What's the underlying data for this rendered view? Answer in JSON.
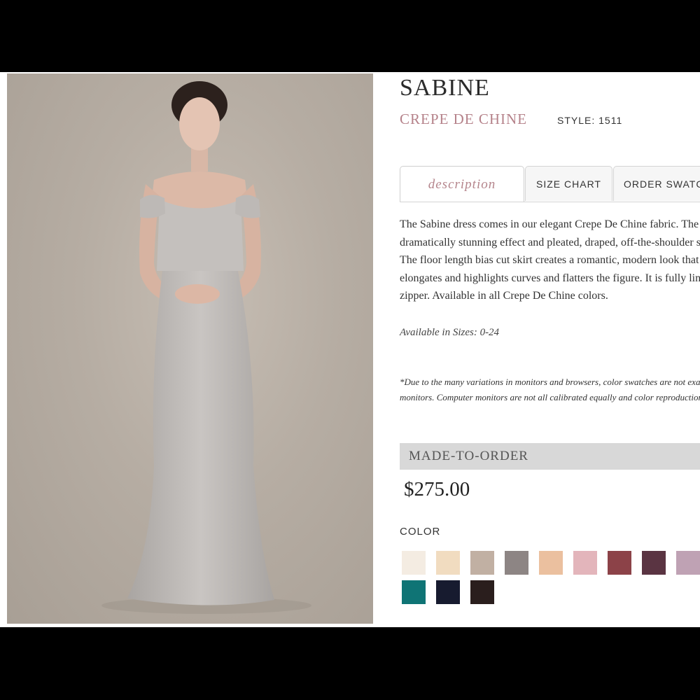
{
  "product": {
    "name": "SABINE",
    "fabric": "CREPE DE CHINE",
    "style": "STYLE: 1511"
  },
  "tabs": [
    {
      "label": "description",
      "active": true
    },
    {
      "label": "SIZE CHART",
      "active": false
    },
    {
      "label": "ORDER SWATCHES",
      "active": false
    }
  ],
  "description": {
    "lines": [
      "The Sabine dress comes in our elegant Crepe De Chine fabric. The bodice features a",
      "dramatically stunning effect and pleated, draped, off-the-shoulder sleeves.",
      "The floor length bias cut skirt creates a romantic, modern look that",
      "elongates and highlights curves and flatters the figure. It is fully lined with a",
      "zipper. Available in all Crepe De Chine colors."
    ],
    "sizes": "Available in Sizes: 0-24",
    "disclaimer_lines": [
      "*Due to the many variations in monitors and browsers, color swatches are not exact on all",
      "monitors. Computer monitors are not all calibrated equally and color reproduction varies."
    ]
  },
  "order": {
    "type_label": "MADE-TO-ORDER",
    "price": "$275.00"
  },
  "color": {
    "label": "COLOR",
    "swatches": [
      {
        "name": "ivory-swatch",
        "hex": "#f4ece2"
      },
      {
        "name": "champagne-swatch",
        "hex": "#f1dcc0"
      },
      {
        "name": "taupe-swatch",
        "hex": "#c1b0a3"
      },
      {
        "name": "grey-swatch",
        "hex": "#8d8584"
      },
      {
        "name": "peach-swatch",
        "hex": "#ebc09f"
      },
      {
        "name": "blush-swatch",
        "hex": "#e3b5bb"
      },
      {
        "name": "rose-swatch",
        "hex": "#8c4248"
      },
      {
        "name": "plum-swatch",
        "hex": "#5a3442"
      },
      {
        "name": "lilac-swatch",
        "hex": "#bfa2b4"
      },
      {
        "name": "teal-swatch",
        "hex": "#0f7475"
      },
      {
        "name": "navy-swatch",
        "hex": "#171b2f"
      },
      {
        "name": "black-swatch",
        "hex": "#2a1e1d"
      }
    ]
  }
}
